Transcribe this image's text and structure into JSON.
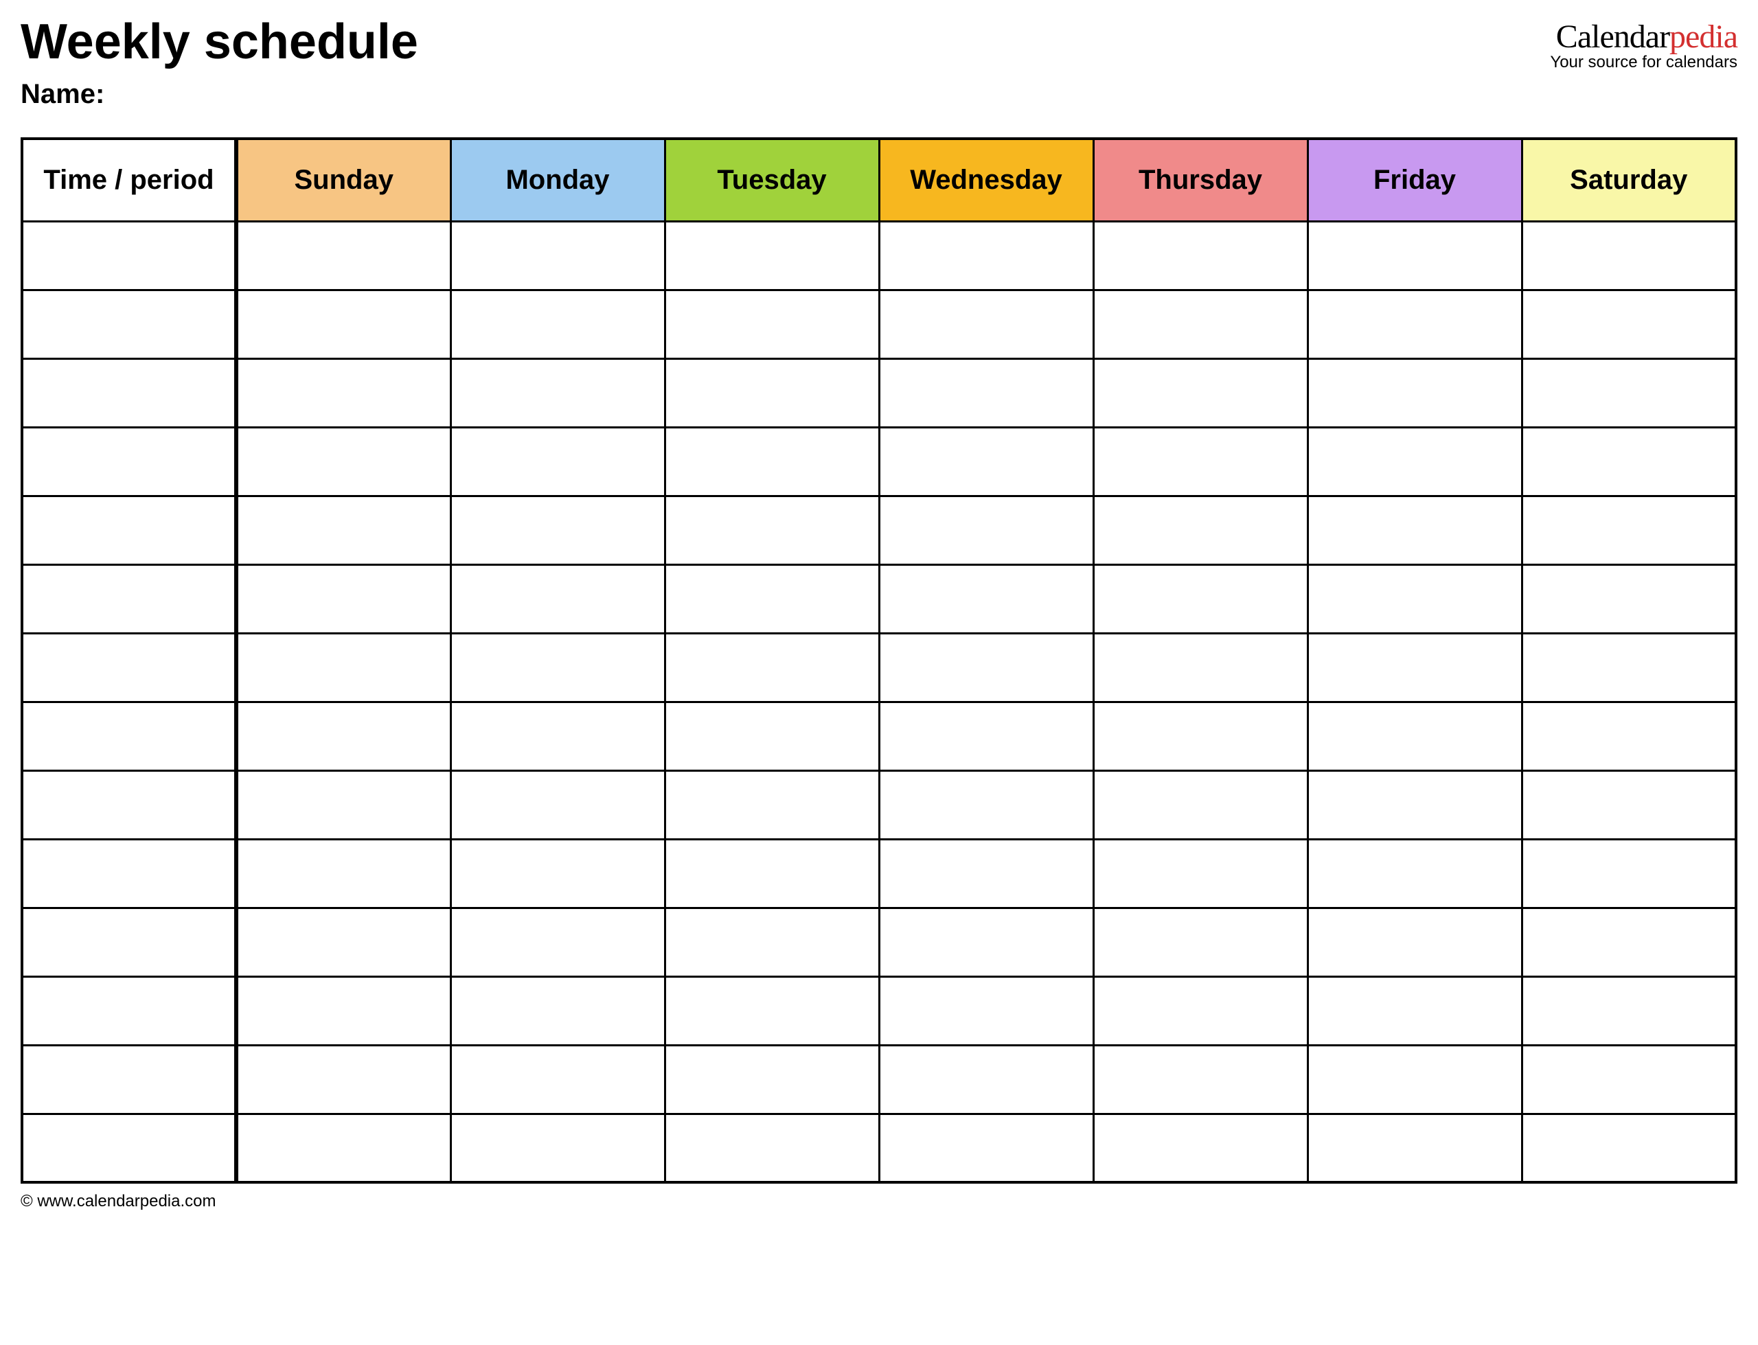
{
  "header": {
    "title": "Weekly schedule",
    "name_label": "Name:"
  },
  "brand": {
    "part1": "Calendar",
    "part2": "pedia",
    "tagline": "Your source for calendars"
  },
  "table": {
    "columns": [
      {
        "label": "Time / period",
        "color": "#ffffff"
      },
      {
        "label": "Sunday",
        "color": "#f7c583"
      },
      {
        "label": "Monday",
        "color": "#9ccaf0"
      },
      {
        "label": "Tuesday",
        "color": "#a0d23b"
      },
      {
        "label": "Wednesday",
        "color": "#f7b71f"
      },
      {
        "label": "Thursday",
        "color": "#f08a8a"
      },
      {
        "label": "Friday",
        "color": "#c899f0"
      },
      {
        "label": "Saturday",
        "color": "#f9f7a8"
      }
    ],
    "row_count": 14
  },
  "footer": {
    "copyright": "© www.calendarpedia.com"
  }
}
